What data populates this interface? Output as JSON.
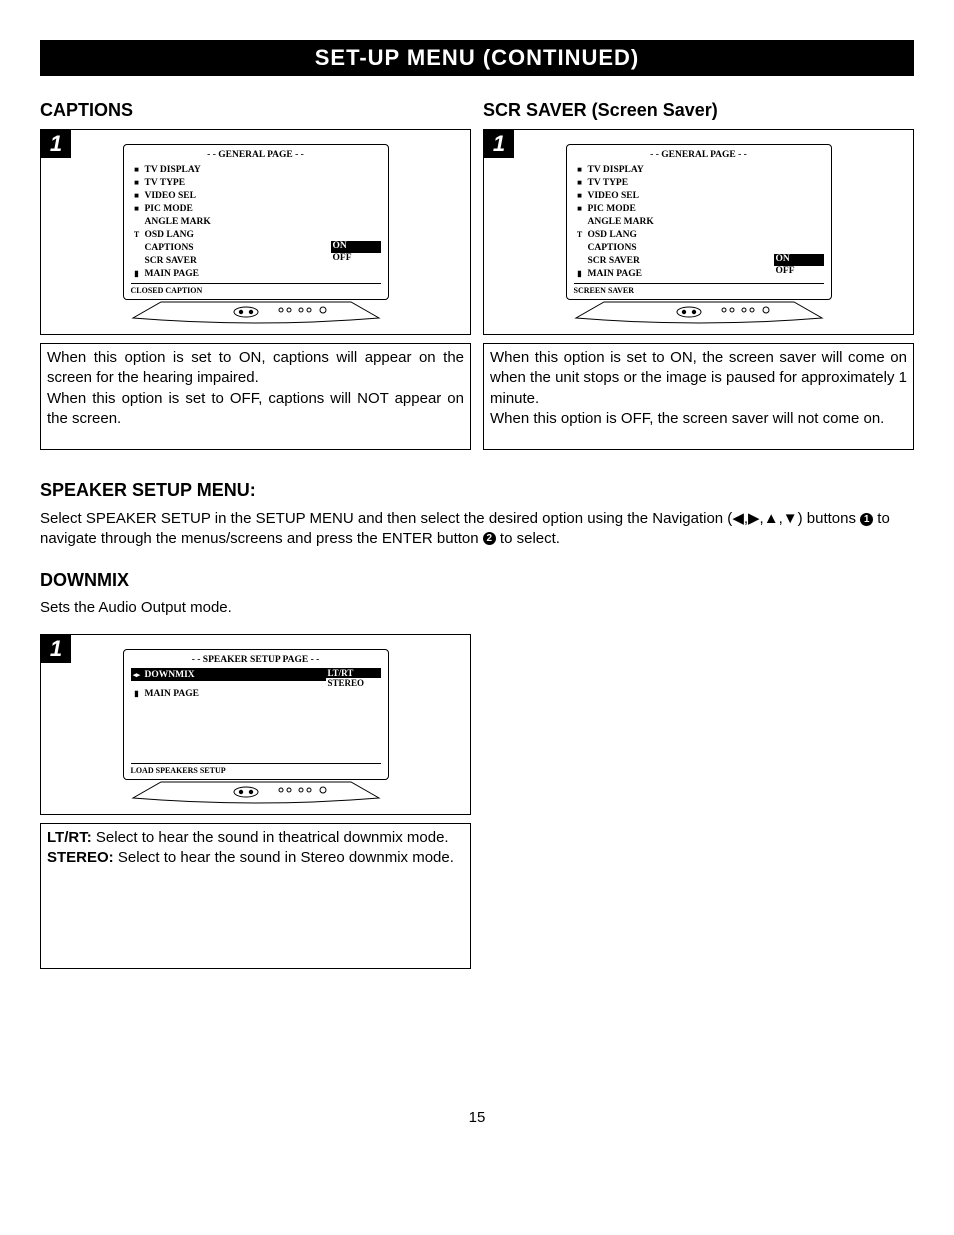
{
  "title_bar": "SET-UP MENU (CONTINUED)",
  "captions": {
    "heading": "CAPTIONS",
    "step": "1",
    "osd": {
      "title": "- - GENERAL PAGE - -",
      "items": [
        {
          "icon": "■",
          "label": "TV DISPLAY"
        },
        {
          "icon": "■",
          "label": "TV TYPE"
        },
        {
          "icon": "■",
          "label": "VIDEO SEL"
        },
        {
          "icon": "■",
          "label": "PIC MODE"
        },
        {
          "icon": "",
          "label": "ANGLE MARK"
        },
        {
          "icon": "T",
          "label": "OSD LANG"
        },
        {
          "icon": "",
          "label": "CAPTIONS"
        },
        {
          "icon": "",
          "label": "SCR SAVER"
        },
        {
          "icon": "▮",
          "label": "MAIN PAGE"
        }
      ],
      "opt_on": "ON",
      "opt_off": "OFF",
      "footer": "CLOSED CAPTION"
    },
    "desc1": "When this option is set to ON, captions will appear on the screen for the hearing impaired.",
    "desc2": "When this option is set to OFF, captions will NOT appear on the screen."
  },
  "scrsaver": {
    "heading": "SCR SAVER (Screen Saver)",
    "step": "1",
    "osd": {
      "title": "- - GENERAL PAGE - -",
      "items": [
        {
          "icon": "■",
          "label": "TV DISPLAY"
        },
        {
          "icon": "■",
          "label": "TV TYPE"
        },
        {
          "icon": "■",
          "label": "VIDEO SEL"
        },
        {
          "icon": "■",
          "label": "PIC MODE"
        },
        {
          "icon": "",
          "label": "ANGLE MARK"
        },
        {
          "icon": "T",
          "label": "OSD LANG"
        },
        {
          "icon": "",
          "label": "CAPTIONS"
        },
        {
          "icon": "",
          "label": "SCR SAVER"
        },
        {
          "icon": "▮",
          "label": "MAIN PAGE"
        }
      ],
      "opt_on": "ON",
      "opt_off": "OFF",
      "footer": "SCREEN SAVER"
    },
    "desc1": "When this option is set to ON, the screen saver will come on when the unit stops or the image is paused for approximately 1 minute.",
    "desc2": "When this option is OFF, the screen saver will not come on."
  },
  "speaker": {
    "heading": "SPEAKER SETUP MENU:",
    "para_a": "Select SPEAKER SETUP in the SETUP MENU and then select the desired option using the Navigation (",
    "arrows": "◀,▶,▲,▼",
    "para_b": ") buttons ",
    "b1": "1",
    "para_c": " to navigate through the menus/screens and press the ENTER button ",
    "b2": "2",
    "para_d": " to select."
  },
  "downmix": {
    "heading": "DOWNMIX",
    "sub": "Sets the Audio Output mode.",
    "step": "1",
    "osd": {
      "title": "- - SPEAKER SETUP PAGE - -",
      "item1_icon": "◂▸",
      "item1": "DOWNMIX",
      "item2_icon": "▮",
      "item2": "MAIN PAGE",
      "opt1": "LT/RT",
      "opt2": "STEREO",
      "footer": "LOAD SPEAKERS SETUP"
    },
    "desc1a": "LT/RT:",
    "desc1b": " Select to hear the sound in theatrical downmix mode.",
    "desc2a": "STEREO:",
    "desc2b": " Select to hear the sound in Stereo downmix mode."
  },
  "page_num": "15"
}
